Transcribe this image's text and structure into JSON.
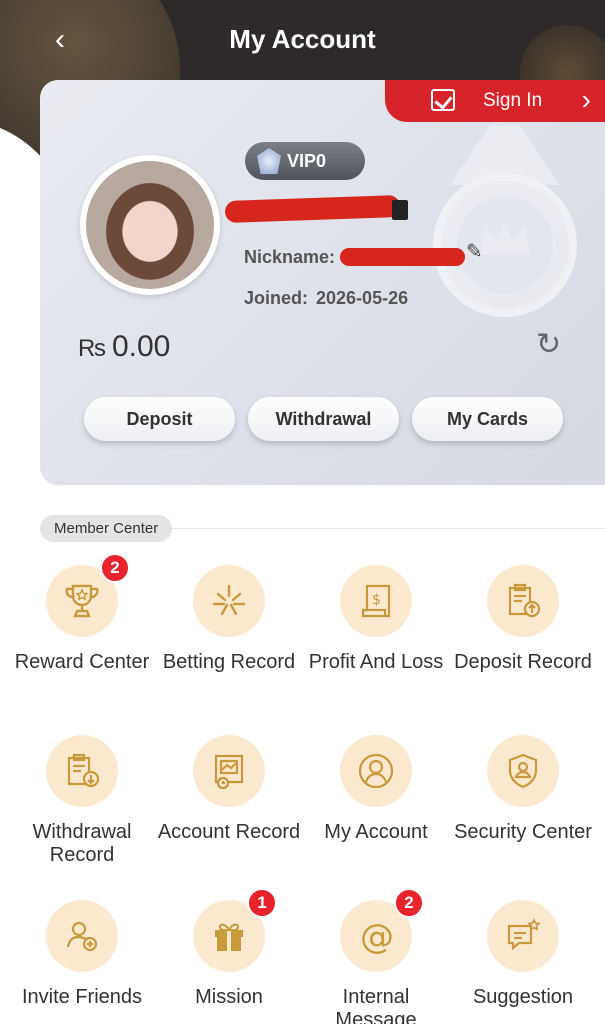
{
  "header": {
    "title": "My Account",
    "back_icon": "chevron-left-icon"
  },
  "account": {
    "sign_in_label": "Sign In",
    "vip_level": "VIP0",
    "nickname_label": "Nickname:",
    "joined_label": "Joined:",
    "joined_date": "2026-05-26",
    "currency": "₨",
    "balance": "0.00"
  },
  "actions": [
    {
      "label": "Deposit"
    },
    {
      "label": "Withdrawal"
    },
    {
      "label": "My Cards"
    }
  ],
  "member_center": {
    "title": "Member Center",
    "items": [
      {
        "label": "Reward Center",
        "icon": "trophy-icon",
        "badge": "2"
      },
      {
        "label": "Betting Record",
        "icon": "betting-icon",
        "badge": ""
      },
      {
        "label": "Profit And Loss",
        "icon": "receipt-icon",
        "badge": ""
      },
      {
        "label": "Deposit Record",
        "icon": "deposit-record-icon",
        "badge": ""
      },
      {
        "label": "Withdrawal Record",
        "icon": "withdrawal-record-icon",
        "badge": ""
      },
      {
        "label": "Account Record",
        "icon": "account-record-icon",
        "badge": ""
      },
      {
        "label": "My Account",
        "icon": "user-icon",
        "badge": ""
      },
      {
        "label": "Security Center",
        "icon": "shield-icon",
        "badge": ""
      },
      {
        "label": "Invite Friends",
        "icon": "invite-icon",
        "badge": ""
      },
      {
        "label": "Mission",
        "icon": "gift-icon",
        "badge": "1"
      },
      {
        "label": "Internal Message",
        "icon": "at-icon",
        "badge": "2"
      },
      {
        "label": "Suggestion",
        "icon": "suggestion-icon",
        "badge": ""
      }
    ]
  },
  "colors": {
    "accent": "#d6242a",
    "icon_bg": "#fbe9cf",
    "icon": "#c99a3c"
  }
}
